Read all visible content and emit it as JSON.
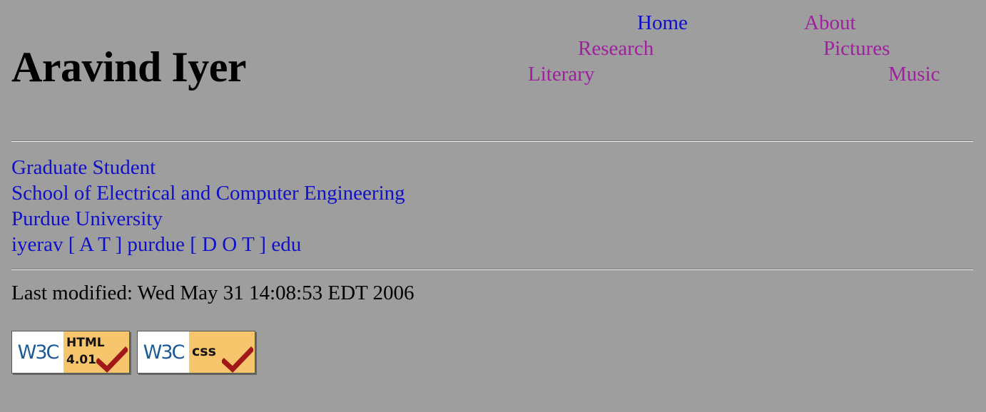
{
  "header": {
    "title": "Aravind Iyer"
  },
  "nav": {
    "home": "Home",
    "about": "About",
    "research": "Research",
    "pictures": "Pictures",
    "literary": "Literary",
    "music": "Music"
  },
  "contact": {
    "role": "Graduate Student",
    "school": "School of Electrical and Computer Engineering",
    "university": "Purdue University",
    "email": "iyerav [ A T ] purdue [ D O T ] edu"
  },
  "footer": {
    "last_modified": "Last modified: Wed May 31 14:08:53 EDT 2006",
    "badges": {
      "html": {
        "logo": "W3C",
        "line1": "HTML",
        "line2": "4.01"
      },
      "css": {
        "logo": "W3C",
        "line1": "css"
      }
    }
  },
  "colors": {
    "background": "#9e9e9e",
    "link": "#1010c8",
    "visited_link": "#a020a0",
    "badge_yellow": "#f7c66c",
    "check_red": "#a01818"
  },
  "icons": {
    "checkmark": "check-mark-icon"
  }
}
